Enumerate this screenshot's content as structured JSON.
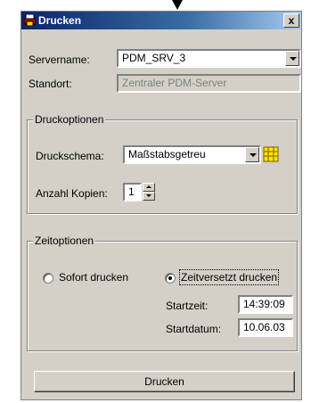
{
  "window": {
    "title": "Drucken",
    "close_glyph": "x",
    "app_icon": "printer-icon"
  },
  "server": {
    "servername_label": "Servername:",
    "servername_value": "PDM_SRV_3",
    "standort_label": "Standort:",
    "standort_value": "Zentraler PDM-Server"
  },
  "druckoptionen": {
    "group_title": "Druckoptionen",
    "schema_label": "Druckschema:",
    "schema_value": "Maßstabsgetreu",
    "schema_icon": "table-icon",
    "kopien_label": "Anzahl Kopien:",
    "kopien_value": "1"
  },
  "zeitoptionen": {
    "group_title": "Zeitoptionen",
    "sofort_label": "Sofort drucken",
    "sofort_selected": false,
    "zeitversetzt_label": "Zeitversetzt drucken",
    "zeitversetzt_selected": true,
    "startzeit_label": "Startzeit:",
    "startzeit_value": "14:39:09",
    "startdatum_label": "Startdatum:",
    "startdatum_value": "10.06.03"
  },
  "actions": {
    "drucken_label": "Drucken"
  },
  "colors": {
    "face": "#d4d0c8",
    "title_start": "#0a246a",
    "title_end": "#a6caf0"
  }
}
